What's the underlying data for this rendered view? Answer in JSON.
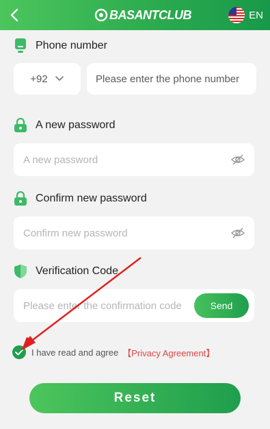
{
  "header": {
    "logo_text": "BASANTCLUB",
    "language": "EN"
  },
  "phone": {
    "label": "Phone number",
    "country_code": "+92",
    "placeholder": "Please enter the phone number"
  },
  "new_password": {
    "label": "A new password",
    "placeholder": "A new password"
  },
  "confirm_password": {
    "label": "Confirm new password",
    "placeholder": "Confirm new password"
  },
  "verification": {
    "label": "Verification Code",
    "placeholder": "Please enter the confirmation code",
    "send_label": "Send"
  },
  "agreement": {
    "text": "I have read and agree",
    "link": "【Privacy Agreement】",
    "checked": true
  },
  "reset_label": "Reset",
  "colors": {
    "accent": "#1f9e4d",
    "link": "#e04545",
    "annotation_arrow": "#e02020"
  }
}
